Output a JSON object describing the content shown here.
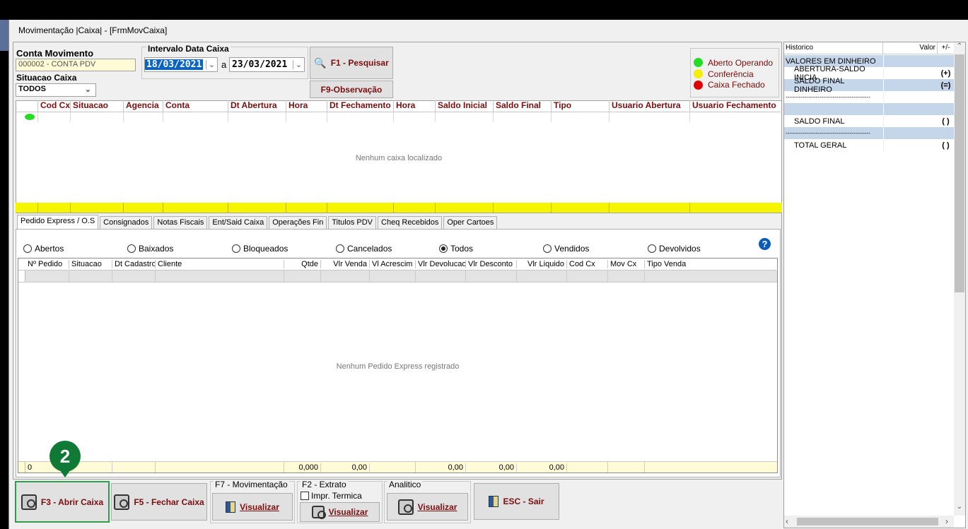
{
  "window": {
    "title": "Movimentação |Caixa| - [FrmMovCaixa]"
  },
  "filters": {
    "conta_movimento_label": "Conta Movimento",
    "conta_movimento_value": "000002 - CONTA PDV",
    "situacao_label": "Situacao Caixa",
    "situacao_value": "TODOS",
    "intervalo_label": "Intervalo Data Caixa",
    "date_from": "18/03/2021",
    "date_sep": "a",
    "date_to": "23/03/2021",
    "pesquisar_label": "F1 - Pesquisar",
    "observacao_label": "F9-Observação"
  },
  "legend": {
    "aberto": "Aberto Operando",
    "conferencia": "Conferência",
    "fechado": "Caixa Fechado",
    "colors": {
      "aberto": "#22dd22",
      "conferencia": "#f5ee00",
      "fechado": "#e00000"
    }
  },
  "caixa_grid": {
    "columns": [
      "Cod Cx",
      "Situacao",
      "Agencia",
      "Conta",
      "Dt Abertura",
      "Hora",
      "Dt Fechamento",
      "Hora",
      "Saldo Inicial",
      "Saldo Final",
      "Tipo",
      "Usuario Abertura",
      "Usuario Fechamento"
    ],
    "empty_message": "Nenhum caixa localizado"
  },
  "tabs": [
    "Pedido Express / O.S",
    "Consignados",
    "Notas Fiscais",
    "Ent/Said Caixa",
    "Operações Fin",
    "Titulos PDV",
    "Cheq Recebidos",
    "Oper Cartoes"
  ],
  "radios": [
    {
      "label": "Abertos",
      "checked": false
    },
    {
      "label": "Baixados",
      "checked": false
    },
    {
      "label": "Bloqueados",
      "checked": false
    },
    {
      "label": "Cancelados",
      "checked": false
    },
    {
      "label": "Todos",
      "checked": true
    },
    {
      "label": "Vendidos",
      "checked": false
    },
    {
      "label": "Devolvidos",
      "checked": false
    }
  ],
  "pedido_grid": {
    "columns": [
      "Nº Pedido",
      "Situacao",
      "Dt Cadastro",
      "Cliente",
      "Qtde",
      "Vlr Venda",
      "Vl Acrescim",
      "Vlr Devolucao",
      "Vlr Desconto",
      "Vlr Liquido",
      "Cod Cx",
      "Mov Cx",
      "Tipo Venda"
    ],
    "empty_message": "Nenhum Pedido Express registrado",
    "footer": {
      "count": "0",
      "qtde": "0,000",
      "venda": "0,00",
      "devolucao": "0,00",
      "desconto": "0,00",
      "liquido": "0,00"
    }
  },
  "bottom": {
    "abrir_caixa": "F3 - Abrir Caixa",
    "fechar_caixa": "F5 - Fechar Caixa",
    "movimentacao_label": "F7 - Movimentação",
    "extrato_label": "F2 - Extrato",
    "impr_termica": "Impr. Termica",
    "analitico_label": "Analitico",
    "visualizar": "Visualizar",
    "sair": "ESC - Sair",
    "badge": "2"
  },
  "historico": {
    "headers": [
      "Historico",
      "Valor",
      "+/-"
    ],
    "rows": [
      {
        "label": "VALORES EM DINHEIRO",
        "sign": "",
        "hl": true
      },
      {
        "label": "ABERTURA-SALDO INICIA",
        "sign": "(+)",
        "hl": false
      },
      {
        "label": "SALDO FINAL DINHEIRO",
        "sign": "(=)",
        "hl": true
      },
      {
        "label": "---------------------------------------------",
        "sign": "",
        "hl": false
      },
      {
        "label": "",
        "sign": "",
        "hl": true
      },
      {
        "label": "SALDO FINAL",
        "sign": "( )",
        "hl": false
      },
      {
        "label": "---------------------------------------------",
        "sign": "",
        "hl": true
      },
      {
        "label": "TOTAL GERAL",
        "sign": "( )",
        "hl": false
      }
    ]
  }
}
